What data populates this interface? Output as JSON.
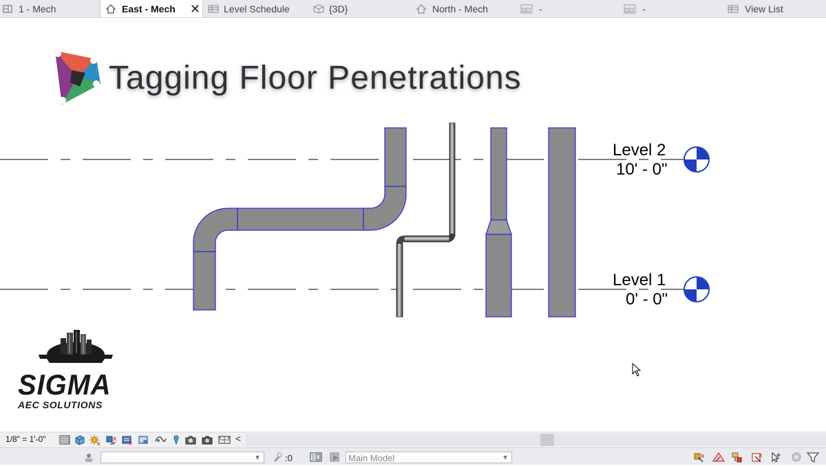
{
  "tabs": [
    {
      "label": "1 - Mech",
      "icon": "floor-plan-icon",
      "active": false
    },
    {
      "label": "East - Mech",
      "icon": "elevation-icon",
      "active": true
    },
    {
      "label": "Level Schedule",
      "icon": "schedule-icon",
      "active": false
    },
    {
      "label": "{3D}",
      "icon": "3d-view-icon",
      "active": false
    },
    {
      "label": "North - Mech",
      "icon": "elevation-icon",
      "active": false
    },
    {
      "label": "-",
      "icon": "sheet-icon",
      "active": false
    },
    {
      "label": "-",
      "icon": "sheet-icon",
      "active": false
    },
    {
      "label": "View List",
      "icon": "schedule-icon",
      "active": false
    }
  ],
  "tab_close": "✕",
  "title": "Tagging Floor Penetrations",
  "levels": [
    {
      "name": "Level 2",
      "elevation": "10' - 0\""
    },
    {
      "name": "Level 1",
      "elevation": "0' - 0\""
    }
  ],
  "brand": {
    "name": "SIGMA",
    "subtitle": "AEC SOLUTIONS"
  },
  "status": {
    "scale": "1/8\" = 1'-0\"",
    "scroll_left": "<",
    "worksets_value": ":0",
    "design_option": "Main Model"
  },
  "colors": {
    "duct_fill": "#8a8a8a",
    "duct_edge": "#2b2bd6",
    "level_head_blue": "#1f3fbf",
    "title_text": "#2f3238"
  }
}
